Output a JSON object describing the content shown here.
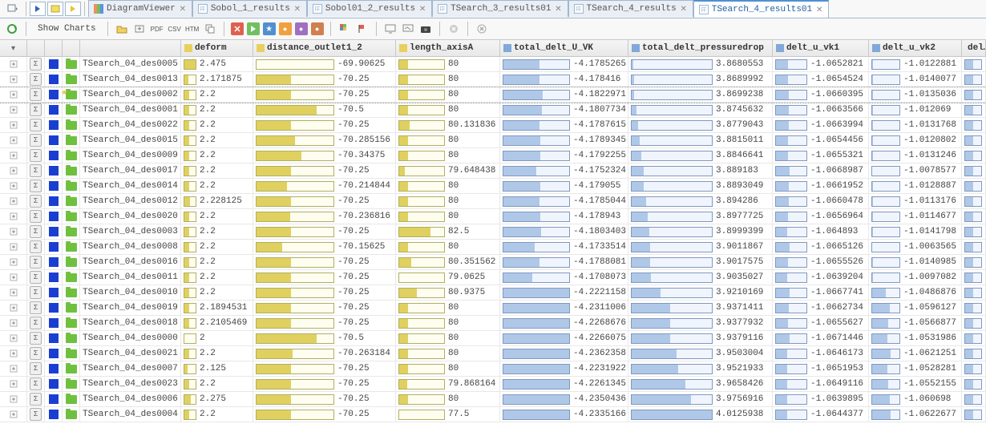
{
  "tabs": {
    "items": [
      {
        "label": "",
        "icon": "play-blue",
        "close": false
      },
      {
        "label": "",
        "icon": "play-yellow",
        "close": false
      },
      {
        "label": "",
        "icon": "play-run",
        "close": false
      },
      {
        "label": "DiagramViewer",
        "icon": "chart",
        "close": true
      },
      {
        "label": "Sobol_1_results",
        "icon": "grid",
        "close": true
      },
      {
        "label": "Sobol01_2_results",
        "icon": "grid",
        "close": true
      },
      {
        "label": "TSearch_3_results01",
        "icon": "grid",
        "close": true
      },
      {
        "label": "TSearch_4_results",
        "icon": "grid",
        "close": true
      },
      {
        "label": "TSearch_4_results01",
        "icon": "grid",
        "close": true,
        "active": true
      }
    ]
  },
  "toolbar": {
    "show_charts": "Show Charts",
    "pdf": "PDF",
    "csv": "CSV",
    "htm": "HTM"
  },
  "columns": [
    {
      "label": "",
      "w": "c0"
    },
    {
      "label": "",
      "w": "c1"
    },
    {
      "label": "",
      "w": "c2"
    },
    {
      "label": "",
      "w": "c3"
    },
    {
      "label": "",
      "w": "c4"
    },
    {
      "label": "deform",
      "w": "c5",
      "icon": "yellow"
    },
    {
      "label": "distance_outlet1_2",
      "w": "c6",
      "icon": "yellow"
    },
    {
      "label": "length_axisA",
      "w": "c7",
      "icon": "yellow"
    },
    {
      "label": "total_delt_U_VK",
      "w": "c8",
      "icon": "blue"
    },
    {
      "label": "total_delt_pressuredrop",
      "w": "c9",
      "icon": "blue"
    },
    {
      "label": "delt_u_vk1",
      "w": "c10",
      "icon": "blue"
    },
    {
      "label": "delt_u_vk2",
      "w": "c11",
      "icon": "blue"
    },
    {
      "label": "del…",
      "w": "c12",
      "icon": "blue"
    }
  ],
  "rows": [
    {
      "name": "TSearch_04_des0005",
      "deform": "2.475",
      "df": 1.0,
      "dist": "-69.90625",
      "db": 0.0,
      "len": "80",
      "lb": 0.2,
      "tvk": "-4.1785265",
      "tvkb": 0.55,
      "tpd": "3.8680553",
      "tpdb": 0.02,
      "v1": "-1.0652821",
      "v1b": 0.4,
      "v2": "-1.0122881",
      "v2b": 0.02
    },
    {
      "name": "TSearch_04_des0013",
      "deform": "2.171875",
      "df": 0.36,
      "dist": "-70.25",
      "db": 0.45,
      "len": "80",
      "lb": 0.2,
      "tvk": "-4.178416",
      "tvkb": 0.55,
      "tpd": "3.8689992",
      "tpdb": 0.03,
      "v1": "-1.0654524",
      "v1b": 0.4,
      "v2": "-1.0140077",
      "v2b": 0.04
    },
    {
      "name": "TSearch_04_des0002",
      "deform": "2.2",
      "df": 0.42,
      "dist": "-70.25",
      "db": 0.45,
      "len": "80",
      "lb": 0.2,
      "tvk": "-4.1822971",
      "tvkb": 0.6,
      "tpd": "3.8699238",
      "tpdb": 0.03,
      "v1": "-1.0660395",
      "v1b": 0.42,
      "v2": "-1.0135036",
      "v2b": 0.03,
      "sel": true,
      "star": true
    },
    {
      "name": "TSearch_04_des0001",
      "deform": "2.2",
      "df": 0.42,
      "dist": "-70.5",
      "db": 0.78,
      "len": "80",
      "lb": 0.2,
      "tvk": "-4.1807734",
      "tvkb": 0.58,
      "tpd": "3.8745632",
      "tpdb": 0.06,
      "v1": "-1.0663566",
      "v1b": 0.43,
      "v2": "-1.012069",
      "v2b": 0.02
    },
    {
      "name": "TSearch_04_des0022",
      "deform": "2.2",
      "df": 0.42,
      "dist": "-70.25",
      "db": 0.45,
      "len": "80.131836",
      "lb": 0.23,
      "tvk": "-4.1787615",
      "tvkb": 0.55,
      "tpd": "3.8779043",
      "tpdb": 0.08,
      "v1": "-1.0663994",
      "v1b": 0.43,
      "v2": "-1.0131768",
      "v2b": 0.03
    },
    {
      "name": "TSearch_04_des0015",
      "deform": "2.2",
      "df": 0.42,
      "dist": "-70.285156",
      "db": 0.5,
      "len": "80",
      "lb": 0.2,
      "tvk": "-4.1789345",
      "tvkb": 0.56,
      "tpd": "3.8815011",
      "tpdb": 0.1,
      "v1": "-1.0654456",
      "v1b": 0.4,
      "v2": "-1.0120802",
      "v2b": 0.02
    },
    {
      "name": "TSearch_04_des0009",
      "deform": "2.2",
      "df": 0.42,
      "dist": "-70.34375",
      "db": 0.58,
      "len": "80",
      "lb": 0.2,
      "tvk": "-4.1792255",
      "tvkb": 0.56,
      "tpd": "3.8846641",
      "tpdb": 0.12,
      "v1": "-1.0655321",
      "v1b": 0.4,
      "v2": "-1.0131246",
      "v2b": 0.03
    },
    {
      "name": "TSearch_04_des0017",
      "deform": "2.2",
      "df": 0.42,
      "dist": "-70.25",
      "db": 0.45,
      "len": "79.648438",
      "lb": 0.12,
      "tvk": "-4.1752324",
      "tvkb": 0.5,
      "tpd": "3.889183",
      "tpdb": 0.15,
      "v1": "-1.0668987",
      "v1b": 0.45,
      "v2": "-1.0078577",
      "v2b": 0.0
    },
    {
      "name": "TSearch_04_des0014",
      "deform": "2.2",
      "df": 0.42,
      "dist": "-70.214844",
      "db": 0.4,
      "len": "80",
      "lb": 0.2,
      "tvk": "-4.179055",
      "tvkb": 0.56,
      "tpd": "3.8893049",
      "tpdb": 0.15,
      "v1": "-1.0661952",
      "v1b": 0.42,
      "v2": "-1.0128887",
      "v2b": 0.02
    },
    {
      "name": "TSearch_04_des0012",
      "deform": "2.228125",
      "df": 0.48,
      "dist": "-70.25",
      "db": 0.45,
      "len": "80",
      "lb": 0.2,
      "tvk": "-4.1785044",
      "tvkb": 0.55,
      "tpd": "3.894286",
      "tpdb": 0.18,
      "v1": "-1.0660478",
      "v1b": 0.42,
      "v2": "-1.0113176",
      "v2b": 0.01
    },
    {
      "name": "TSearch_04_des0020",
      "deform": "2.2",
      "df": 0.42,
      "dist": "-70.236816",
      "db": 0.44,
      "len": "80",
      "lb": 0.2,
      "tvk": "-4.178943",
      "tvkb": 0.56,
      "tpd": "3.8977725",
      "tpdb": 0.2,
      "v1": "-1.0656964",
      "v1b": 0.4,
      "v2": "-1.0114677",
      "v2b": 0.01
    },
    {
      "name": "TSearch_04_des0003",
      "deform": "2.2",
      "df": 0.42,
      "dist": "-70.25",
      "db": 0.45,
      "len": "82.5",
      "lb": 0.7,
      "tvk": "-4.1803403",
      "tvkb": 0.57,
      "tpd": "3.8999399",
      "tpdb": 0.22,
      "v1": "-1.064893",
      "v1b": 0.38,
      "v2": "-1.0141798",
      "v2b": 0.04
    },
    {
      "name": "TSearch_04_des0008",
      "deform": "2.2",
      "df": 0.42,
      "dist": "-70.15625",
      "db": 0.33,
      "len": "80",
      "lb": 0.2,
      "tvk": "-4.1733514",
      "tvkb": 0.48,
      "tpd": "3.9011867",
      "tpdb": 0.23,
      "v1": "-1.0665126",
      "v1b": 0.44,
      "v2": "-1.0063565",
      "v2b": 0.0
    },
    {
      "name": "TSearch_04_des0016",
      "deform": "2.2",
      "df": 0.42,
      "dist": "-70.25",
      "db": 0.45,
      "len": "80.351562",
      "lb": 0.27,
      "tvk": "-4.1788081",
      "tvkb": 0.55,
      "tpd": "3.9017575",
      "tpdb": 0.23,
      "v1": "-1.0655526",
      "v1b": 0.4,
      "v2": "-1.0140985",
      "v2b": 0.04
    },
    {
      "name": "TSearch_04_des0011",
      "deform": "2.2",
      "df": 0.42,
      "dist": "-70.25",
      "db": 0.45,
      "len": "79.0625",
      "lb": 0.0,
      "tvk": "-4.1708073",
      "tvkb": 0.44,
      "tpd": "3.9035027",
      "tpdb": 0.24,
      "v1": "-1.0639204",
      "v1b": 0.36,
      "v2": "-1.0097082",
      "v2b": 0.01
    },
    {
      "name": "TSearch_04_des0010",
      "deform": "2.2",
      "df": 0.42,
      "dist": "-70.25",
      "db": 0.45,
      "len": "80.9375",
      "lb": 0.39,
      "tvk": "-4.2221158",
      "tvkb": 1.0,
      "tpd": "3.9210169",
      "tpdb": 0.36,
      "v1": "-1.0667741",
      "v1b": 0.45,
      "v2": "-1.0486876",
      "v2b": 0.5
    },
    {
      "name": "TSearch_04_des0019",
      "deform": "2.1894531",
      "df": 0.4,
      "dist": "-70.25",
      "db": 0.45,
      "len": "80",
      "lb": 0.2,
      "tvk": "-4.2311006",
      "tvkb": 1.0,
      "tpd": "3.9371411",
      "tpdb": 0.48,
      "v1": "-1.0662734",
      "v1b": 0.43,
      "v2": "-1.0596127",
      "v2b": 0.65
    },
    {
      "name": "TSearch_04_des0018",
      "deform": "2.2105469",
      "df": 0.44,
      "dist": "-70.25",
      "db": 0.45,
      "len": "80",
      "lb": 0.2,
      "tvk": "-4.2268676",
      "tvkb": 1.0,
      "tpd": "3.9377932",
      "tpdb": 0.48,
      "v1": "-1.0655627",
      "v1b": 0.4,
      "v2": "-1.0566877",
      "v2b": 0.6
    },
    {
      "name": "TSearch_04_des0000",
      "deform": "2",
      "df": 0.0,
      "dist": "-70.5",
      "db": 0.78,
      "len": "80",
      "lb": 0.2,
      "tvk": "-4.2266075",
      "tvkb": 1.0,
      "tpd": "3.9379116",
      "tpdb": 0.48,
      "v1": "-1.0671446",
      "v1b": 0.46,
      "v2": "-1.0531986",
      "v2b": 0.56
    },
    {
      "name": "TSearch_04_des0021",
      "deform": "2.2",
      "df": 0.42,
      "dist": "-70.263184",
      "db": 0.47,
      "len": "80",
      "lb": 0.2,
      "tvk": "-4.2362358",
      "tvkb": 1.0,
      "tpd": "3.9503004",
      "tpdb": 0.56,
      "v1": "-1.0646173",
      "v1b": 0.37,
      "v2": "-1.0621251",
      "v2b": 0.68
    },
    {
      "name": "TSearch_04_des0007",
      "deform": "2.125",
      "df": 0.26,
      "dist": "-70.25",
      "db": 0.45,
      "len": "80",
      "lb": 0.2,
      "tvk": "-4.2231922",
      "tvkb": 1.0,
      "tpd": "3.9521933",
      "tpdb": 0.58,
      "v1": "-1.0651953",
      "v1b": 0.38,
      "v2": "-1.0528281",
      "v2b": 0.56
    },
    {
      "name": "TSearch_04_des0023",
      "deform": "2.2",
      "df": 0.42,
      "dist": "-70.25",
      "db": 0.45,
      "len": "79.868164",
      "lb": 0.17,
      "tvk": "-4.2261345",
      "tvkb": 1.0,
      "tpd": "3.9658426",
      "tpdb": 0.67,
      "v1": "-1.0649116",
      "v1b": 0.38,
      "v2": "-1.0552155",
      "v2b": 0.59
    },
    {
      "name": "TSearch_04_des0006",
      "deform": "2.275",
      "df": 0.58,
      "dist": "-70.25",
      "db": 0.45,
      "len": "80",
      "lb": 0.2,
      "tvk": "-4.2350436",
      "tvkb": 1.0,
      "tpd": "3.9756916",
      "tpdb": 0.74,
      "v1": "-1.0639895",
      "v1b": 0.36,
      "v2": "-1.060698",
      "v2b": 0.66
    },
    {
      "name": "TSearch_04_des0004",
      "deform": "2.2",
      "df": 0.42,
      "dist": "-70.25",
      "db": 0.45,
      "len": "77.5",
      "lb": 0.0,
      "tvk": "-4.2335166",
      "tvkb": 1.0,
      "tpd": "4.0125938",
      "tpdb": 1.0,
      "v1": "-1.0644377",
      "v1b": 0.37,
      "v2": "-1.0622677",
      "v2b": 0.68
    }
  ]
}
